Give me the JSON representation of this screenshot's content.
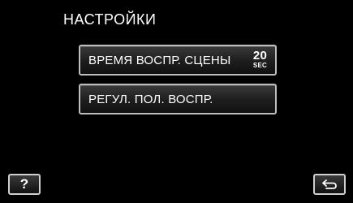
{
  "screen": {
    "title": "НАСТРОЙКИ"
  },
  "menu": {
    "items": [
      {
        "label": "ВРЕМЯ ВОСПР. СЦЕНЫ",
        "value": "20",
        "unit": "SEC"
      },
      {
        "label": "РЕГУЛ. ПОЛ. ВОСПР."
      }
    ]
  },
  "footer": {
    "help_label": "?",
    "back_icon": "return-arrow-icon"
  },
  "colors": {
    "background": "#000000",
    "button_border": "#bdbdbd",
    "text": "#ffffff"
  }
}
